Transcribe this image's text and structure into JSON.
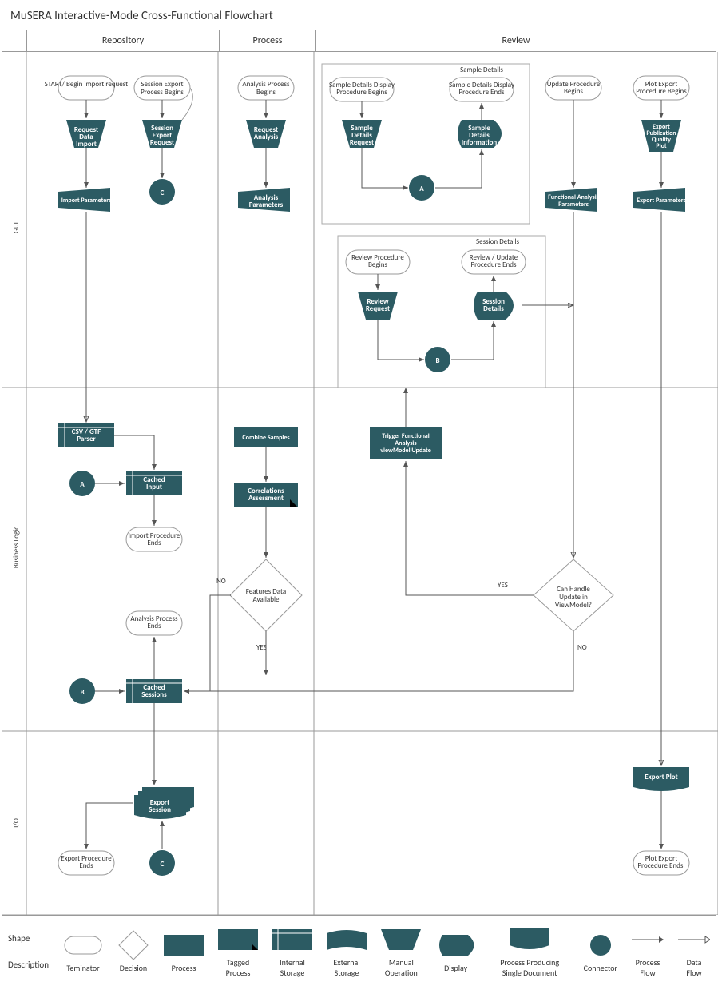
{
  "title": "MuSERA Interactive-Mode Cross-Functional Flowchart",
  "columns": [
    "Repository",
    "Process",
    "Review"
  ],
  "lanes": [
    "GUI",
    "Business Logic",
    "I/O"
  ],
  "shapes": {
    "start_import": "START/ Begin import request",
    "request_import": "Request Data Import",
    "import_params": "Import Parameters",
    "session_export_begin": "Session Export Process Begins",
    "session_export_req": "Session Export Request",
    "conn_c1": "C",
    "analysis_begin": "Analysis Process Begins",
    "request_analysis": "Request Analysis",
    "analysis_params": "Analysis Parameters",
    "sample_details_box": "Sample Details",
    "sample_disp_begin": "Sample Details Display Procedure Begins",
    "sample_disp_end": "Sample Details Display Procedure Ends",
    "sample_req": "Sample Details Request",
    "sample_info": "Sample Details Information",
    "conn_a1": "A",
    "session_details_box": "Session Details",
    "review_begin": "Review Procedure Begins",
    "review_end": "Review / Update Procedure Ends",
    "review_req": "Review Request",
    "session_details": "Session Details",
    "conn_b1": "B",
    "update_begin": "Update Procedure Begins",
    "func_params": "Functional Analysis Parameters",
    "plot_begin": "Plot Export Procedure Begins",
    "export_pub": "Export Publication Quality Plot",
    "export_params": "Export Parameters",
    "csv_parser": "CSV / GTF Parser",
    "conn_a2": "A",
    "cached_input": "Cached Input",
    "import_end": "Import Procedure Ends",
    "combine": "Combine Samples",
    "correlations": "Correlations Assessment",
    "decision_features": "Features Data Available",
    "no": "NO",
    "yes": "YES",
    "analysis_end": "Analysis Process Ends",
    "conn_b2": "B",
    "cached_sessions": "Cached Sessions",
    "trigger_func": "Trigger Functional Analysis viewModel Update",
    "decision_handle": "Can Handle Update in ViewModel?",
    "export_session": "Export Session",
    "conn_c2": "C",
    "export_end": "Export Procedure Ends",
    "export_plot": "Export Plot",
    "plot_end": "Plot Export Procedure Ends."
  },
  "legend": {
    "shape_label": "Shape",
    "desc_label": "Description",
    "items": [
      "Teminator",
      "Decision",
      "Process",
      "Tagged Process",
      "Internal Storage",
      "External Storage",
      "Manual Operation",
      "Display",
      "Process Producing Single Document",
      "Connector",
      "Process Flow",
      "Data Flow"
    ]
  },
  "colors": {
    "fill": "#2c5b63",
    "text": "#fff",
    "line": "#555"
  }
}
